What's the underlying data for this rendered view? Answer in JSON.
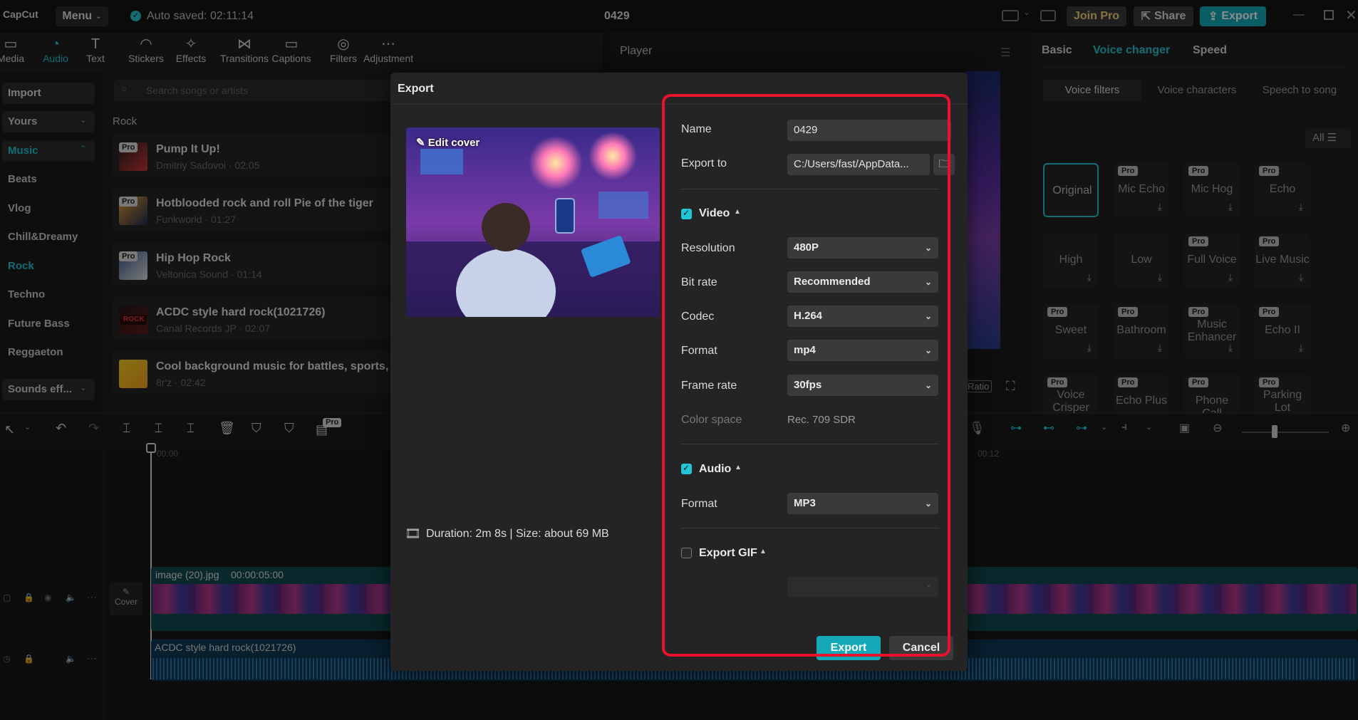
{
  "topbar": {
    "logo": "CapCut",
    "menu_label": "Menu",
    "autosave": "Auto saved: 02:11:14",
    "project_title": "0429",
    "join_pro": "Join Pro",
    "share": "Share",
    "export": "Export"
  },
  "toolbar": {
    "tools": [
      {
        "label": "Media",
        "icon": "media-icon"
      },
      {
        "label": "Audio",
        "icon": "audio-icon"
      },
      {
        "label": "Text",
        "icon": "text-icon"
      },
      {
        "label": "Stickers",
        "icon": "stickers-icon"
      },
      {
        "label": "Effects",
        "icon": "effects-icon"
      },
      {
        "label": "Transitions",
        "icon": "transitions-icon"
      },
      {
        "label": "Captions",
        "icon": "captions-icon"
      },
      {
        "label": "Filters",
        "icon": "filters-icon"
      },
      {
        "label": "Adjustment",
        "icon": "adjustment-icon"
      }
    ],
    "active": "Audio"
  },
  "leftnav": {
    "import": "Import",
    "yours": "Yours",
    "music": "Music",
    "items": [
      "Beats",
      "Vlog",
      "Chill&Dreamy",
      "Rock",
      "Techno",
      "Future Bass",
      "Reggaeton"
    ],
    "active": "Rock",
    "sounds": "Sounds eff..."
  },
  "music": {
    "search_placeholder": "Search songs or artists",
    "category": "Rock",
    "songs": [
      {
        "title": "Pump It Up!",
        "meta": "Dmitriy Sadovoi · 02:05",
        "badge": "Pro"
      },
      {
        "title": "Hotblooded rock and roll Pie of the tiger",
        "meta": "Funkworld · 01:27",
        "badge": "Pro"
      },
      {
        "title": "Hip Hop Rock",
        "meta": "Veltonica Sound · 01:14",
        "badge": "Pro"
      },
      {
        "title": "ACDC style hard rock(1021726)",
        "meta": "Canal Records JP · 02:07",
        "badge": "ROCK"
      },
      {
        "title": "Cool background music for battles, sports,",
        "meta": "8r'z · 02:42",
        "badge": ""
      }
    ]
  },
  "player": {
    "title": "Player",
    "ratio": "Ratio"
  },
  "rightpanel": {
    "tabs": [
      "Basic",
      "Voice changer",
      "Speed"
    ],
    "active_tab": "Voice changer",
    "subtabs": [
      "Voice filters",
      "Voice characters",
      "Speech to song"
    ],
    "active_subtab": "Voice filters",
    "filter_label": "All",
    "cards": [
      {
        "label": "Original",
        "pro": false,
        "dl": false
      },
      {
        "label": "Mic Echo",
        "pro": true,
        "dl": true
      },
      {
        "label": "Mic Hog",
        "pro": true,
        "dl": true
      },
      {
        "label": "Echo",
        "pro": true,
        "dl": true
      },
      {
        "label": "High",
        "pro": false,
        "dl": true
      },
      {
        "label": "Low",
        "pro": false,
        "dl": true
      },
      {
        "label": "Full Voice",
        "pro": true,
        "dl": true
      },
      {
        "label": "Live Music",
        "pro": true,
        "dl": true
      },
      {
        "label": "Sweet",
        "pro": true,
        "dl": true
      },
      {
        "label": "Bathroom",
        "pro": true,
        "dl": true
      },
      {
        "label": "Music Enhancer",
        "pro": true,
        "dl": true
      },
      {
        "label": "Echo II",
        "pro": true,
        "dl": true
      },
      {
        "label": "Voice Crisper",
        "pro": true,
        "dl": false
      },
      {
        "label": "Echo Plus",
        "pro": true,
        "dl": false
      },
      {
        "label": "Phone Call",
        "pro": true,
        "dl": false
      },
      {
        "label": "Parking Lot",
        "pro": true,
        "dl": false
      }
    ],
    "pro_label": "Pro"
  },
  "timeline": {
    "time_start": "00:00",
    "time_mark": "00:12",
    "cover": "Cover",
    "video_clip": "image (20).jpg",
    "video_duration": "00:00:05:00",
    "audio_clip": "ACDC style hard rock(1021726)",
    "pro_badge": "Pro"
  },
  "export": {
    "title": "Export",
    "edit_cover": "Edit cover",
    "name_label": "Name",
    "name_value": "0429",
    "export_to_label": "Export to",
    "export_to_value": "C:/Users/fast/AppData...",
    "video_section": "Video",
    "video_checked": true,
    "resolution_label": "Resolution",
    "resolution_value": "480P",
    "bitrate_label": "Bit rate",
    "bitrate_value": "Recommended",
    "codec_label": "Codec",
    "codec_value": "H.264",
    "format_label": "Format",
    "format_value": "mp4",
    "framerate_label": "Frame rate",
    "framerate_value": "30fps",
    "colorspace_label": "Color space",
    "colorspace_value": "Rec. 709 SDR",
    "audio_section": "Audio",
    "audio_checked": true,
    "audio_format_label": "Format",
    "audio_format_value": "MP3",
    "gif_section": "Export GIF",
    "gif_checked": false,
    "duration_info": "Duration: 2m 8s | Size: about 69 MB",
    "export_button": "Export",
    "cancel_button": "Cancel"
  },
  "colors": {
    "accent": "#21c6d6",
    "highlight": "#e8122d",
    "bg": "#181818"
  }
}
